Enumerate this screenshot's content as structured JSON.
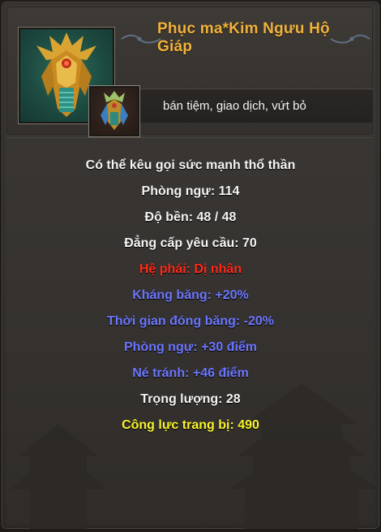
{
  "item": {
    "name": "Phục ma*Kim Ngưu Hộ Giáp",
    "actions_note": "bán tiệm, giao dịch, vứt bỏ",
    "portrait_icon": "golden-armor-icon",
    "thumb_icon": "armor-thumbnail-icon"
  },
  "stats": [
    {
      "text": "Có thể kêu gọi sức mạnh thổ thần",
      "color": "white"
    },
    {
      "text": "Phòng ngự: 114",
      "color": "white"
    },
    {
      "text": "Độ bền:  48 /  48",
      "color": "white"
    },
    {
      "text": "Đẳng cấp yêu cầu: 70",
      "color": "white"
    },
    {
      "text": "Hệ phái: Dị nhân",
      "color": "red"
    },
    {
      "text": "Kháng băng: +20%",
      "color": "blue"
    },
    {
      "text": "Thời gian đóng băng: -20%",
      "color": "blue"
    },
    {
      "text": "Phòng ngự: +30 điểm",
      "color": "blue"
    },
    {
      "text": "Né tránh: +46 điểm",
      "color": "blue"
    },
    {
      "text": "Trọng lượng: 28",
      "color": "white"
    },
    {
      "text": "Công lực trang bị: 490",
      "color": "yellow"
    }
  ],
  "colors": {
    "title": "#f0b23b",
    "white": "#f4f4f4",
    "red": "#ff2a1a",
    "blue": "#6b76ff",
    "yellow": "#f7f32a"
  }
}
